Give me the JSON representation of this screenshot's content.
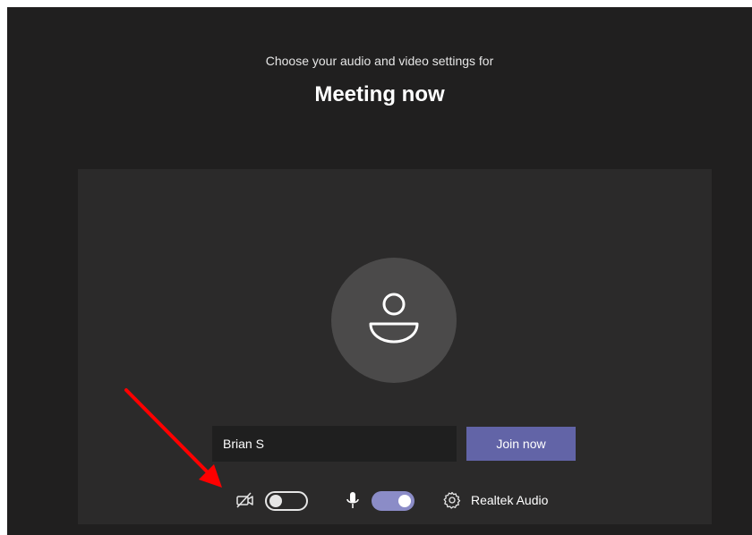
{
  "header": {
    "subtitle": "Choose your audio and video settings for",
    "title": "Meeting now"
  },
  "prejoin": {
    "avatar_icon": "person-icon",
    "name_value": "Brian S",
    "join_label": "Join now"
  },
  "controls": {
    "camera_icon": "camera-off-icon",
    "camera_on": false,
    "mic_icon": "microphone-icon",
    "mic_on": true,
    "settings_icon": "gear-icon",
    "audio_device_label": "Realtek Audio"
  },
  "annotation": {
    "arrow_icon": "red-arrow-icon",
    "arrow_color": "#ff0000"
  },
  "colors": {
    "window_bg": "#201f1f",
    "panel_bg": "#2b2a2a",
    "accent": "#6264a7",
    "toggle_on": "#8b8cc7"
  }
}
